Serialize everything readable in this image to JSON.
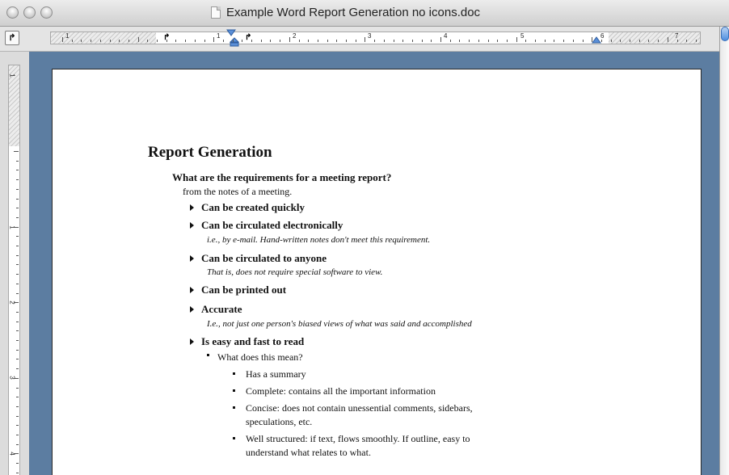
{
  "window": {
    "title": "Example Word Report Generation no icons.doc"
  },
  "ruler": {
    "numbers": [
      "1",
      "1",
      "2",
      "3",
      "4",
      "5",
      "6",
      "7"
    ],
    "vertical_numbers": [
      "1",
      "1",
      "2",
      "3",
      "4"
    ]
  },
  "document": {
    "heading": "Report Generation",
    "question": "What are the requirements for a meeting report?",
    "subtitle": "from the notes of a meeting.",
    "items": [
      {
        "label": "Can be created quickly"
      },
      {
        "label": "Can be circulated electronically",
        "note": "i.e., by e-mail. Hand-written notes don't meet this requirement."
      },
      {
        "label": "Can be circulated to anyone",
        "note": "That is, does not require special software to view."
      },
      {
        "label": "Can be printed out"
      },
      {
        "label": "Accurate",
        "note": "I.e., not just one person's biased views of what was said and accomplished"
      },
      {
        "label": "Is easy and fast to read"
      }
    ],
    "sub_bullet": "What does this mean?",
    "sub_items": [
      {
        "line1": "Has a summary"
      },
      {
        "line1": "Complete: contains all the important information"
      },
      {
        "line1": "Concise: does not contain unessential comments, sidebars,",
        "line2": "speculations, etc."
      },
      {
        "line1": "Well structured: if text, flows smoothly. If outline, easy to",
        "line2": "understand what relates to what."
      }
    ]
  }
}
